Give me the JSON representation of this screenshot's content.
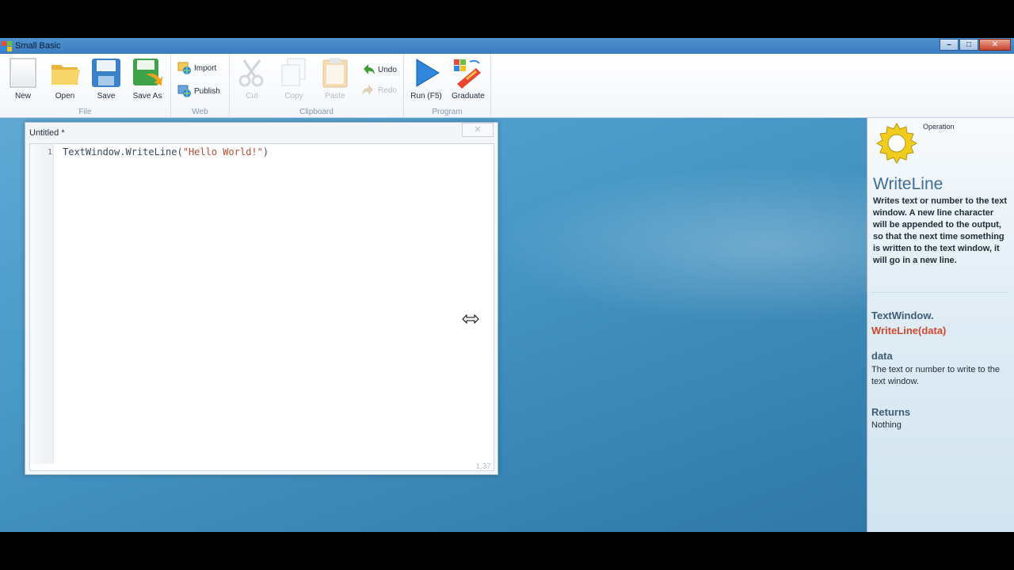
{
  "window": {
    "title": "Small Basic",
    "minimize_label": "–",
    "maximize_label": "□",
    "close_label": "✕"
  },
  "ribbon": {
    "file": {
      "label": "File",
      "new_label": "New",
      "open_label": "Open",
      "save_label": "Save",
      "save_as_label": "Save As"
    },
    "web": {
      "label": "Web",
      "import_label": "Import",
      "publish_label": "Publish"
    },
    "clipboard": {
      "label": "Clipboard",
      "cut_label": "Cut",
      "copy_label": "Copy",
      "paste_label": "Paste",
      "undo_label": "Undo",
      "redo_label": "Redo"
    },
    "program": {
      "label": "Program",
      "run_label": "Run (F5)",
      "graduate_label": "Graduate"
    }
  },
  "editor": {
    "title": "Untitled *",
    "close_label": "✕",
    "lines": [
      {
        "number": "1",
        "ident": "TextWindow.WriteLine(",
        "string": "\"Hello World!\"",
        "tail": ")"
      }
    ],
    "status": "1,37"
  },
  "help": {
    "type": "Operation",
    "name": "WriteLine",
    "description": "Writes text or number to the text window.  A new line character will be appended to the output, so that the next time something is written to the text window, it will go in a new line.",
    "signature_object": "TextWindow.",
    "signature_method": "WriteLine(data)",
    "param_name": "data",
    "param_description": "The text or number to write to the text window.",
    "returns_label": "Returns",
    "returns_value": "Nothing"
  },
  "colors": {
    "accent": "#3d6e98",
    "method_highlight": "#d24a2e",
    "string": "#b94a2e"
  }
}
